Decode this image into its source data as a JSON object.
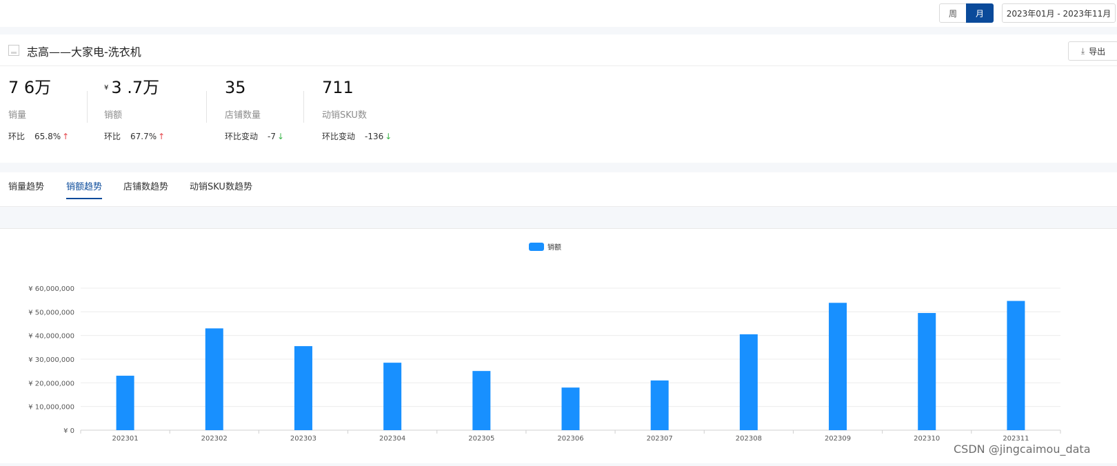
{
  "toolbar": {
    "week_label": "周",
    "month_label": "月",
    "date_range": "2023年01月 - 2023年11月"
  },
  "header": {
    "title": "志高——大家电-洗衣机",
    "export_label": "导出"
  },
  "kpis": [
    {
      "value": "7 6万",
      "label": "销量",
      "change_label": "环比",
      "change_value": "65.8%",
      "direction": "up"
    },
    {
      "currency": "¥",
      "value": "3 .7万",
      "label": "销额",
      "change_label": "环比",
      "change_value": "67.7%",
      "direction": "up"
    },
    {
      "value": "35",
      "label": "店铺数量",
      "change_label": "环比变动",
      "change_value": "-7",
      "direction": "down"
    },
    {
      "value": "711",
      "label": "动销SKU数",
      "change_label": "环比变动",
      "change_value": "-136",
      "direction": "down"
    }
  ],
  "tabs": [
    {
      "label": "销量趋势",
      "active": false
    },
    {
      "label": "销额趋势",
      "active": true
    },
    {
      "label": "店铺数趋势",
      "active": false
    },
    {
      "label": "动销SKU数趋势",
      "active": false
    }
  ],
  "colors": {
    "accent": "#0a4a9a",
    "bar": "#1890ff",
    "up": "#e5484d",
    "down": "#3bb54a"
  },
  "chart_data": {
    "type": "bar",
    "categories": [
      "202301",
      "202302",
      "202303",
      "202304",
      "202305",
      "202306",
      "202307",
      "202308",
      "202309",
      "202310",
      "202311"
    ],
    "series": [
      {
        "name": "销额",
        "values": [
          23000000,
          43000000,
          35500000,
          28500000,
          25000000,
          18000000,
          21000000,
          40500000,
          53800000,
          49500000,
          54600000
        ]
      }
    ],
    "yticks": [
      "¥ 0",
      "¥ 10,000,000",
      "¥ 20,000,000",
      "¥ 30,000,000",
      "¥ 40,000,000",
      "¥ 50,000,000",
      "¥ 60,000,000"
    ],
    "ylim": [
      0,
      60000000
    ],
    "grid": true,
    "legend": "top-center"
  },
  "watermark": "CSDN @jingcaimou_data"
}
